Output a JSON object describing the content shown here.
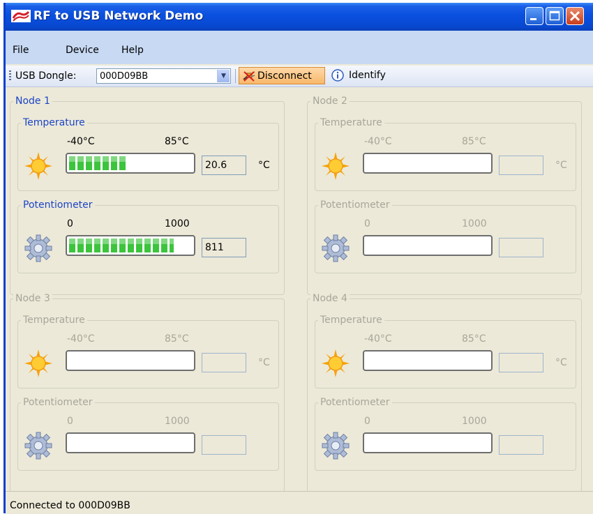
{
  "window": {
    "title": "RF to USB Network Demo",
    "icon": "silabs-logo-icon"
  },
  "menu": {
    "items": [
      "File",
      "Device",
      "Help"
    ]
  },
  "toolbar": {
    "dongle_label": "USB Dongle:",
    "dongle_value": "000D09BB",
    "disconnect_label": "Disconnect",
    "identify_label": "Identify"
  },
  "nodes": [
    {
      "title": "Node 1",
      "enabled": true,
      "temperature": {
        "title": "Temperature",
        "min": "-40°C",
        "max": "85°C",
        "value": "20.6",
        "unit": "°C",
        "level": 0.48
      },
      "potentiometer": {
        "title": "Potentiometer",
        "min": "0",
        "max": "1000",
        "value": "811",
        "level": 0.85
      }
    },
    {
      "title": "Node 2",
      "enabled": false,
      "temperature": {
        "title": "Temperature",
        "min": "-40°C",
        "max": "85°C",
        "value": "",
        "unit": "°C",
        "level": 0
      },
      "potentiometer": {
        "title": "Potentiometer",
        "min": "0",
        "max": "1000",
        "value": "",
        "level": 0
      }
    },
    {
      "title": "Node 3",
      "enabled": false,
      "temperature": {
        "title": "Temperature",
        "min": "-40°C",
        "max": "85°C",
        "value": "",
        "unit": "°C",
        "level": 0
      },
      "potentiometer": {
        "title": "Potentiometer",
        "min": "0",
        "max": "1000",
        "value": "",
        "level": 0
      }
    },
    {
      "title": "Node 4",
      "enabled": false,
      "temperature": {
        "title": "Temperature",
        "min": "-40°C",
        "max": "85°C",
        "value": "",
        "unit": "°C",
        "level": 0
      },
      "potentiometer": {
        "title": "Potentiometer",
        "min": "0",
        "max": "1000",
        "value": "",
        "level": 0
      }
    }
  ],
  "status": {
    "text": "Connected to 000D09BB"
  },
  "colors": {
    "titlebar": "#0a50df",
    "menubar": "#c7d9f3",
    "panel": "#ece9d8",
    "progress": "#3cc43c",
    "group_title_active": "#1c45c6",
    "disabled_text": "#a7a69a"
  }
}
